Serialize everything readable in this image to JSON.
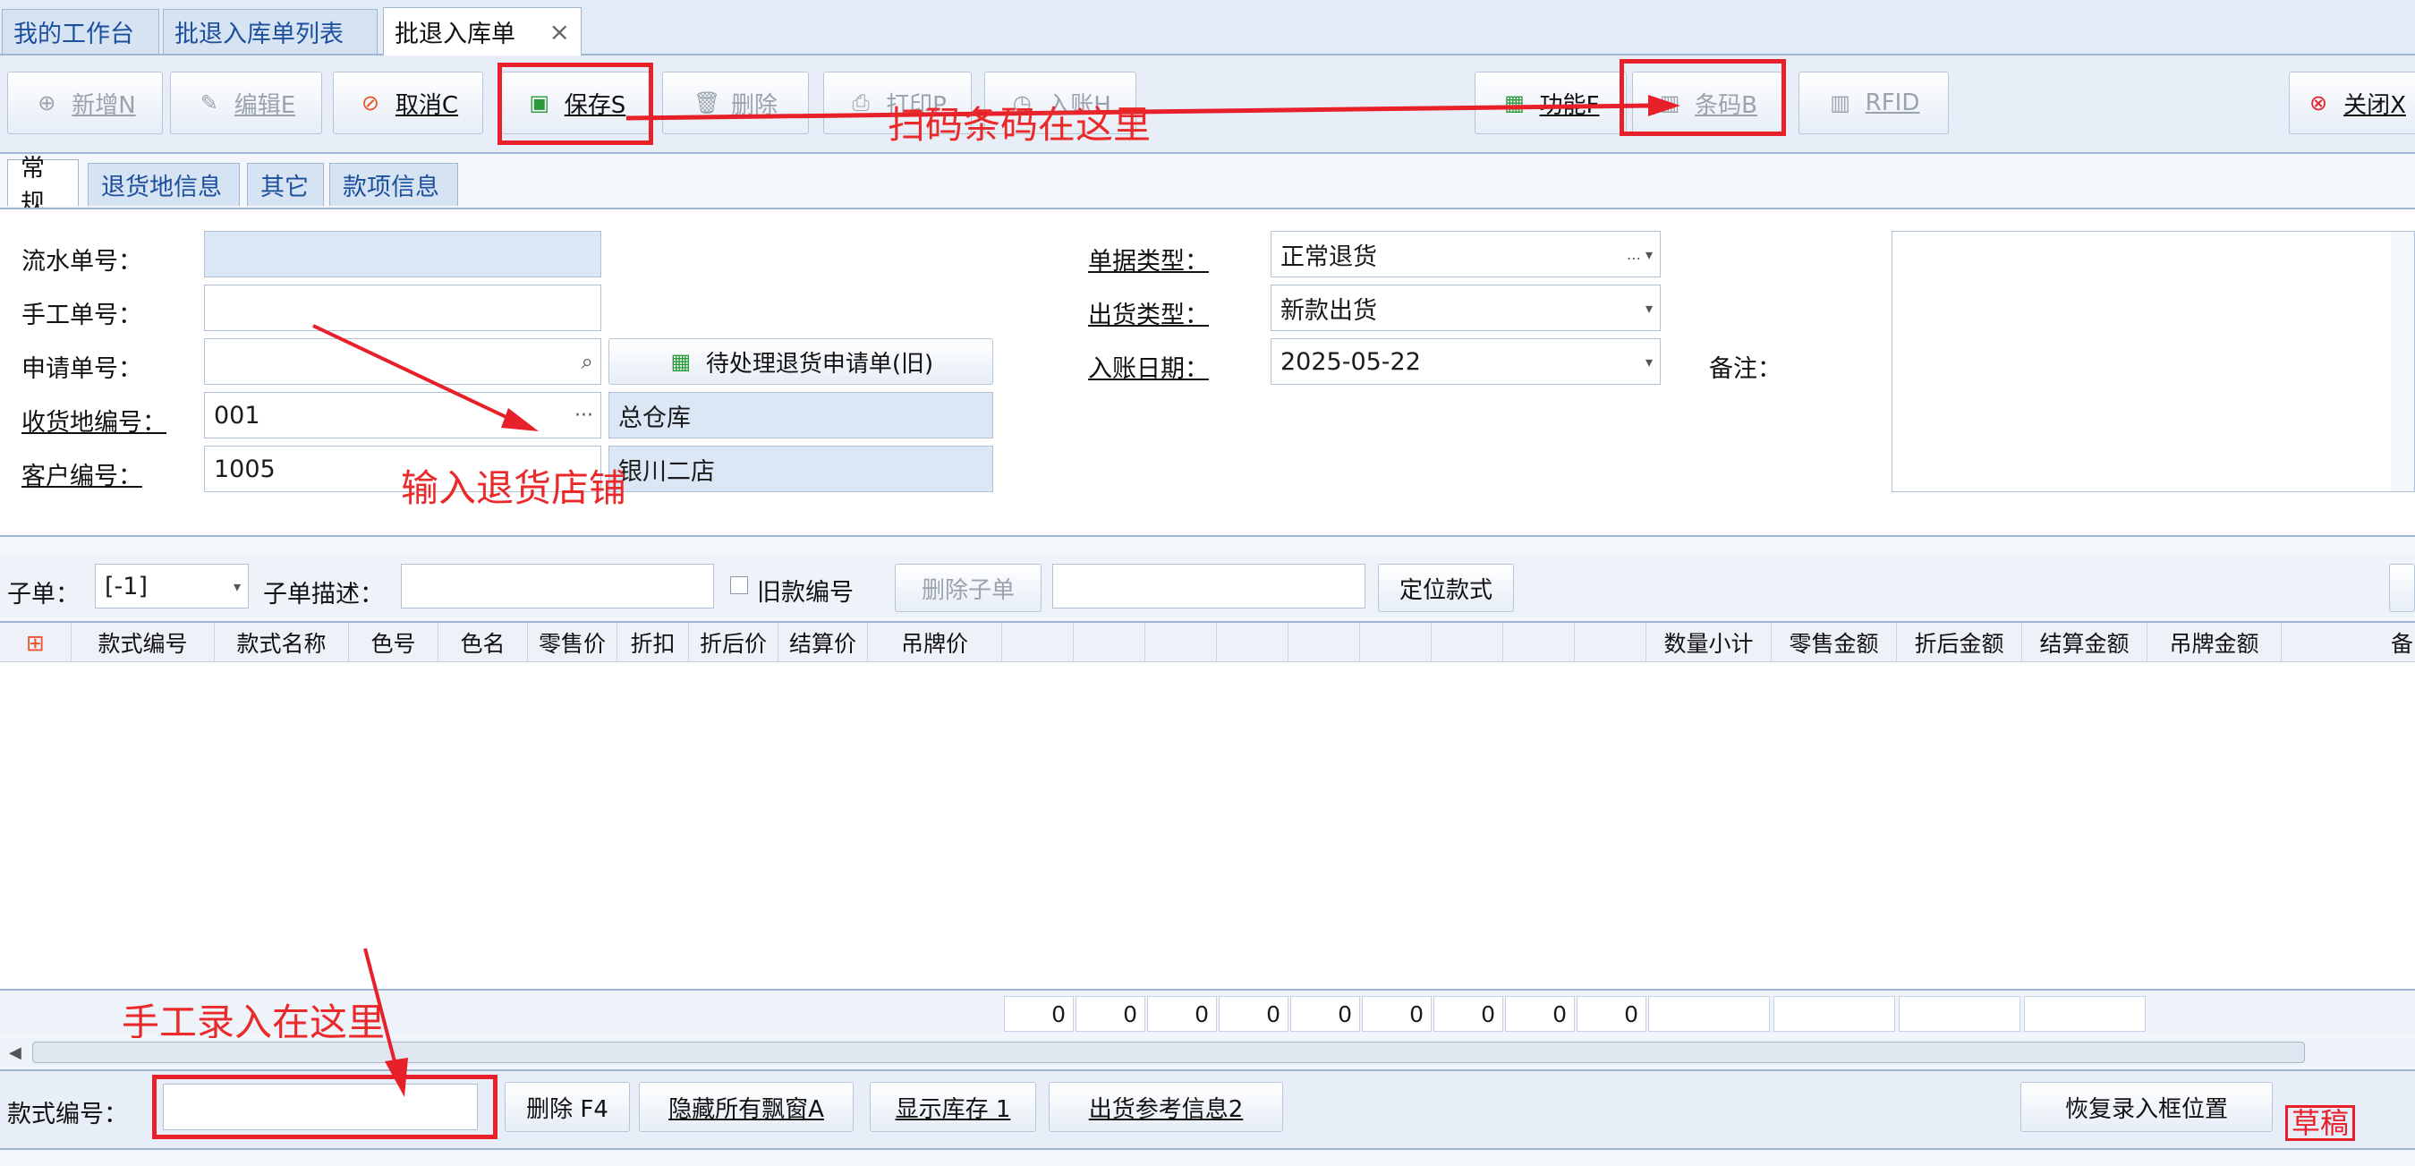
{
  "tabs": [
    {
      "label": "我的工作台"
    },
    {
      "label": "批退入库单列表"
    },
    {
      "label": "批退入库单",
      "close": "×"
    }
  ],
  "toolbar": {
    "new": "新增N",
    "edit": "编辑E",
    "cancel": "取消C",
    "save": "保存S",
    "delete": "删除",
    "print": "打印P",
    "inbound": "入账H",
    "function": "功能F",
    "barcode": "条码B",
    "rfid": "RFID",
    "close": "关闭X"
  },
  "annotations": {
    "scan_here": "扫码条码在这里",
    "enter_store": "输入退货店铺",
    "manual_here": "手工录入在这里",
    "draft": "草稿"
  },
  "subtabs": [
    "常规",
    "退货地信息",
    "其它",
    "款项信息"
  ],
  "form": {
    "serial_label": "流水单号：",
    "serial_value": "",
    "manual_label": "手工单号：",
    "manual_value": "",
    "apply_label": "申请单号：",
    "apply_value": "",
    "pending_button": "待处理退货申请单(旧)",
    "receive_label": "收货地编号：",
    "receive_value": "001",
    "receive_name": "总仓库",
    "customer_label": "客户编号：",
    "customer_value": "1005",
    "customer_name": "银川二店",
    "doc_type_label": "单据类型：",
    "doc_type_value": "正常退货",
    "ship_type_label": "出货类型：",
    "ship_type_value": "新款出货",
    "entry_date_label": "入账日期：",
    "entry_date_value": "2025-05-22",
    "remark_label": "备注："
  },
  "subform": {
    "sub_label": "子单：",
    "sub_value": "[-1]",
    "desc_label": "子单描述：",
    "desc_value": "",
    "old_code_label": "旧款编号",
    "delete_sub": "删除子单",
    "locate": "定位款式"
  },
  "grid": {
    "columns": [
      "款式编号",
      "款式名称",
      "色号",
      "色名",
      "零售价",
      "折扣",
      "折后价",
      "结算价",
      "吊牌价",
      "数量小计",
      "零售金额",
      "折后金额",
      "结算金额",
      "吊牌金额",
      "备"
    ],
    "footer_zeros": [
      "0",
      "0",
      "0",
      "0",
      "0",
      "0",
      "0",
      "0",
      "0"
    ]
  },
  "bottom": {
    "style_label": "款式编号：",
    "style_value": "",
    "delete_f4": "删除 F4",
    "hide_windows": "隐藏所有飘窗A",
    "show_stock": "显示库存 1",
    "ship_ref": "出货参考信息2",
    "restore": "恢复录入框位置"
  },
  "colors": {
    "accent": "#1c4f9c",
    "annotation": "#e8202a"
  }
}
